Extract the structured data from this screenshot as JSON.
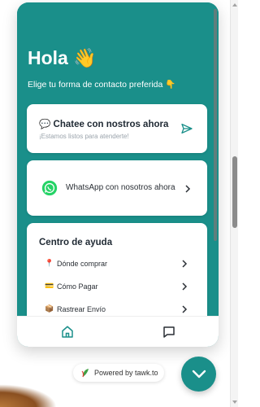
{
  "widget": {
    "greeting": "Hola 👋",
    "subtitle": "Elige tu forma de contacto preferida 👇",
    "accent_color": "#1a8f8a",
    "chat_card": {
      "title": "💬 Chatee con nostros ahora",
      "subtitle": "¡Estamos listos para atenderte!",
      "icon": "send-icon"
    },
    "whatsapp_card": {
      "label": "WhatsApp con nosotros ahora",
      "icon": "whatsapp-icon"
    },
    "help_center": {
      "title": "Centro de ayuda",
      "items": [
        {
          "icon": "📍",
          "label": "Dónde comprar"
        },
        {
          "icon": "💳",
          "label": "Cómo Pagar"
        },
        {
          "icon": "📦",
          "label": "Rastrear Envío"
        }
      ]
    },
    "nav": {
      "home": "home-icon",
      "messages": "message-icon"
    }
  },
  "powered_by": "Powered by tawk.to",
  "launcher": {
    "icon": "chevron-down-icon"
  }
}
